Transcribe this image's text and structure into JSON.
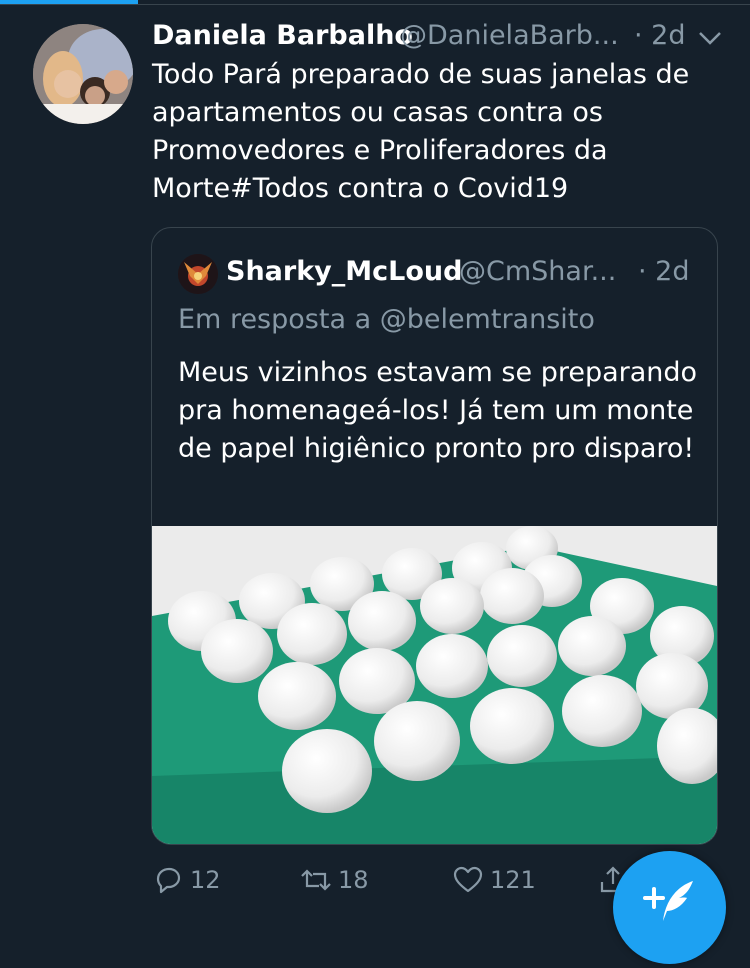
{
  "tweet": {
    "author_name": "Daniela Barbalho",
    "author_handle": "@DanielaBarb...",
    "time": "· 2d",
    "text": "Todo Pará preparado de suas janelas de apartamentos ou casas contra os Promovedores e Proliferadores da Morte#Todos contra o Covid19"
  },
  "quoted_tweet": {
    "author_name": "Sharky_McLoud",
    "author_handle": "@CmShar...",
    "time": "· 2d",
    "reply_to": "Em resposta a @belemtransito",
    "text": "Meus vizinhos estavam se preparando pra homenageá-los! Já tem um monte de papel higiênico pronto pro disparo!"
  },
  "actions": {
    "reply_count": "12",
    "retweet_count": "18",
    "like_count": "121"
  },
  "icons": {
    "reply": "reply-icon",
    "retweet": "retweet-icon",
    "like": "heart-icon",
    "share": "share-icon",
    "compose": "compose-tweet-icon",
    "more": "chevron-down-icon"
  },
  "colors": {
    "background": "#15202b",
    "accent": "#1da1f2",
    "secondary_text": "#8899a6",
    "border": "#38444d",
    "tray_green": "#1e9a78"
  }
}
